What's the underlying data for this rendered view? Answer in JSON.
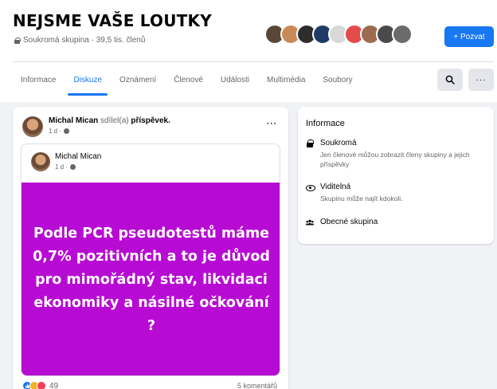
{
  "group": {
    "title": "NEJSME VAŠE LOUTKY",
    "meta": "Soukromá skupina · 39,5 tis. členů",
    "invite_label": "+ Pozvat"
  },
  "member_avatars": [
    "#5a4636",
    "#c98a5a",
    "#2d2d2d",
    "#1f3a66",
    "#d8d8d8",
    "#e34a4a",
    "#9a6b4f",
    "#4a4a4a",
    "#6b6b6b"
  ],
  "tabs": [
    {
      "label": "Informace",
      "active": false
    },
    {
      "label": "Diskuze",
      "active": true
    },
    {
      "label": "Oznámení",
      "active": false
    },
    {
      "label": "Členové",
      "active": false
    },
    {
      "label": "Události",
      "active": false
    },
    {
      "label": "Multimédia",
      "active": false
    },
    {
      "label": "Soubory",
      "active": false
    }
  ],
  "toolbar": {
    "search_icon": "search-icon",
    "more_label": "···"
  },
  "post": {
    "author": "Michal Mican",
    "action": " sdílel(a) ",
    "object": "příspěvek.",
    "time": "1 d ·",
    "menu_label": "···",
    "shared": {
      "author": "Michal Mican",
      "time": "1 d ·",
      "text": "Podle PCR pseudotestů máme 0,7% pozitivních a to je důvod pro mimořádný stav, likvidaci ekonomiky a násilné očkování ?"
    },
    "reaction_count": "49",
    "comments": "5 komentářů"
  },
  "info": {
    "title": "Informace",
    "private_label": "Soukromá",
    "private_desc": "Jen členové můžou zobrazit členy skupiny a jejich příspěvky",
    "visible_label": "Viditelná",
    "visible_desc": "Skupinu může najít kdokoli.",
    "type_label": "Obecné skupina"
  },
  "colors": {
    "accent": "#1877f2",
    "post_background": "#b70bd3"
  }
}
